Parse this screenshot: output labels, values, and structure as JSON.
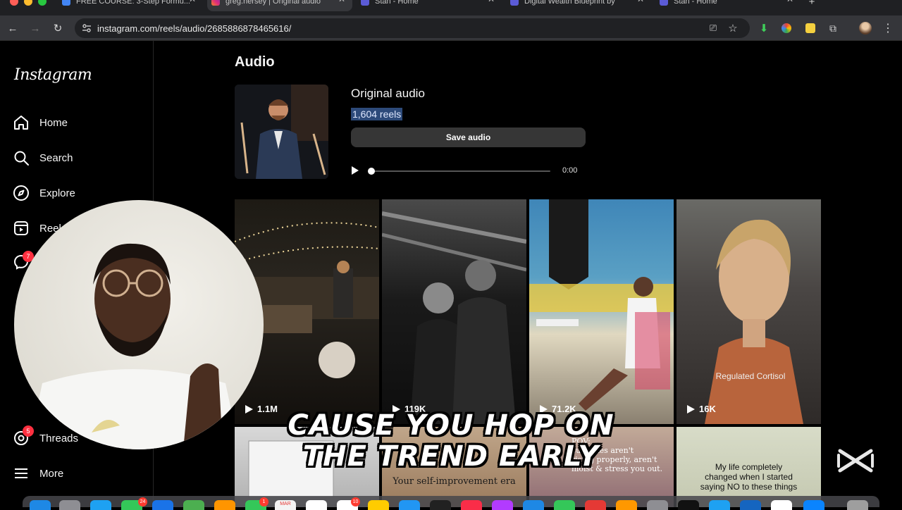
{
  "browser": {
    "tabs": [
      {
        "title": "FREE COURSE: 3-Step Formu..."
      },
      {
        "title": "greg.hersey | Original audio"
      },
      {
        "title": "Stan - Home"
      },
      {
        "title": "Digital Wealth Blueprint by"
      },
      {
        "title": "Stan - Home"
      }
    ],
    "url": "instagram.com/reels/audio/2685886878465616/"
  },
  "sidebar": {
    "logo": "Instagram",
    "items": [
      {
        "label": "Home",
        "icon": "home-icon"
      },
      {
        "label": "Search",
        "icon": "search-icon"
      },
      {
        "label": "Explore",
        "icon": "compass-icon"
      },
      {
        "label": "Reels",
        "icon": "reels-icon"
      },
      {
        "label": "Threads",
        "icon": "threads-icon",
        "badge": "5"
      },
      {
        "label": "More",
        "icon": "menu-icon"
      }
    ],
    "messages_badge": "7"
  },
  "audio": {
    "heading": "Audio",
    "title": "Original audio",
    "reels_count": "1,604 reels",
    "save_label": "Save audio",
    "time": "0:00",
    "progress": 0
  },
  "reels": [
    {
      "views": "1.1M"
    },
    {
      "views": "119K"
    },
    {
      "views": "71.2K"
    },
    {
      "views": "16K",
      "overlay_text": "Regulated Cortisol"
    }
  ],
  "reels_row2": [
    {
      "overlay_text": ""
    },
    {
      "overlay_text": "Your self-improvement era"
    },
    {
      "overlay_text": "POV:\ncupcakes aren't\nrising properly, aren't\nmoist & stress you out."
    },
    {
      "overlay_text": "My life completely\nchanged when I started\nsaying NO to these things"
    }
  ],
  "video_caption": "CAUSE YOU HOP ON\nTHE TREND EARLY",
  "dock": {
    "badges": [
      "24",
      "1",
      "10"
    ],
    "calendar_month": "MAR"
  }
}
